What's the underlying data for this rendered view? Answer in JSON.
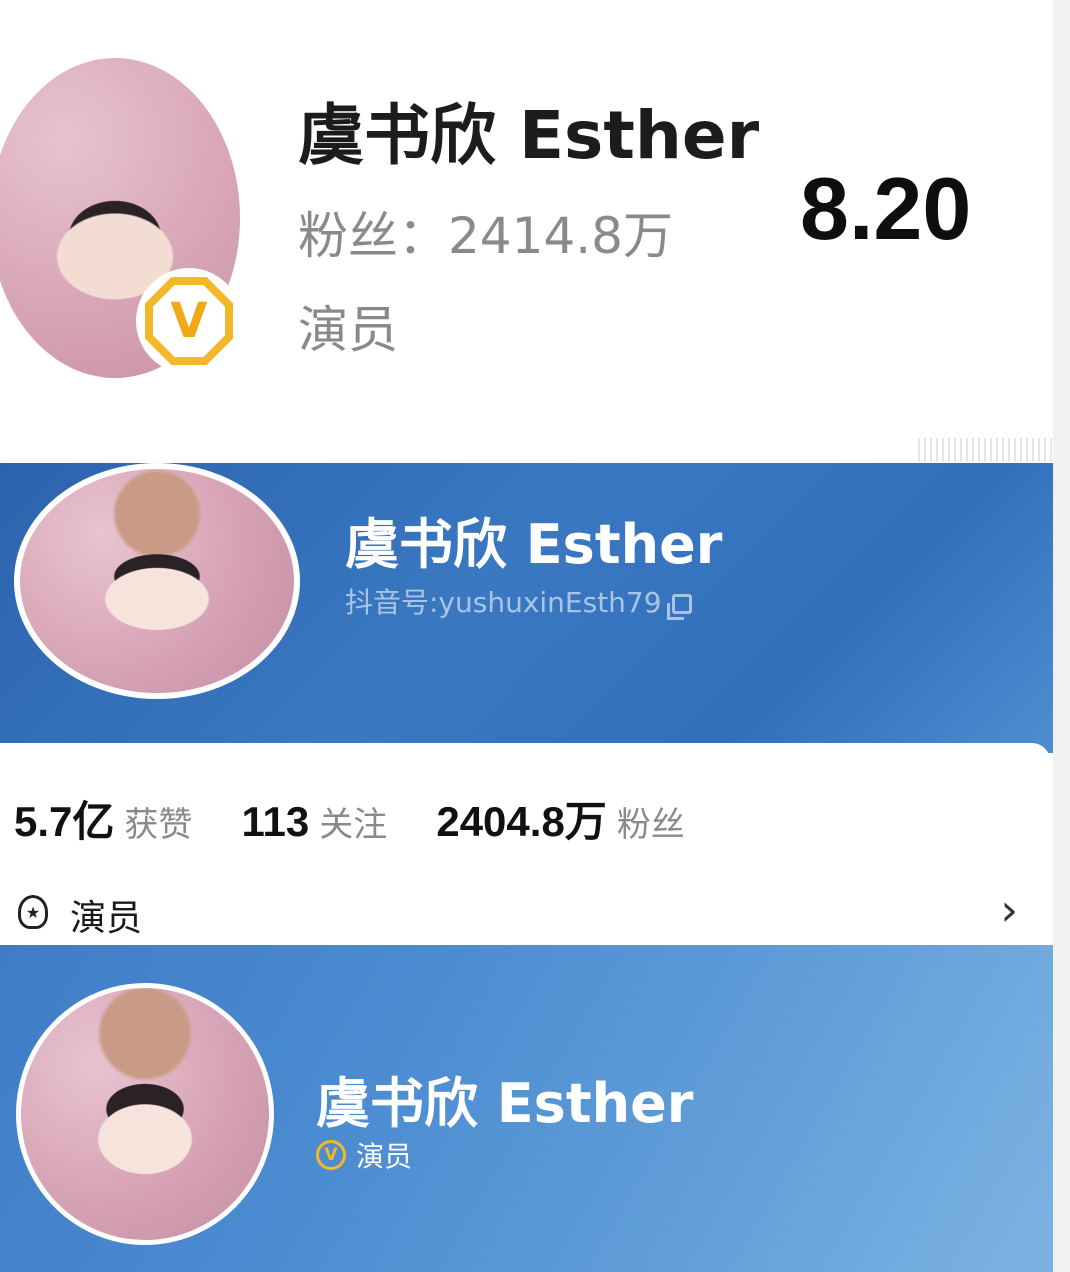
{
  "weibo_profile": {
    "name": "虞书欣 Esther",
    "fans": "粉丝：2414.8万",
    "role": "演员",
    "date_overlay": "8.20",
    "verify_badge": "V"
  },
  "douyin_profile": {
    "name": "虞书欣 Esther",
    "handle": "抖音号:yushuxinEsth79",
    "stats": [
      {
        "value": "5.7亿",
        "label": "获赞"
      },
      {
        "value": "113",
        "label": "关注"
      },
      {
        "value": "2404.8万",
        "label": "粉丝"
      }
    ],
    "role": "演员",
    "chevron": "›",
    "banner_color": "#2c63ae"
  },
  "douyin_header_2": {
    "name": "虞书欣 Esther",
    "verify_badge": "V",
    "role": "演员",
    "banner_color": "#4b8bd0"
  },
  "colors": {
    "verify_gold": "#f2b82a",
    "muted_text": "#8a8a8a"
  },
  "icons": [
    "copy-icon",
    "actor-badge-icon",
    "chevron-right-icon",
    "verified-v-icon"
  ]
}
